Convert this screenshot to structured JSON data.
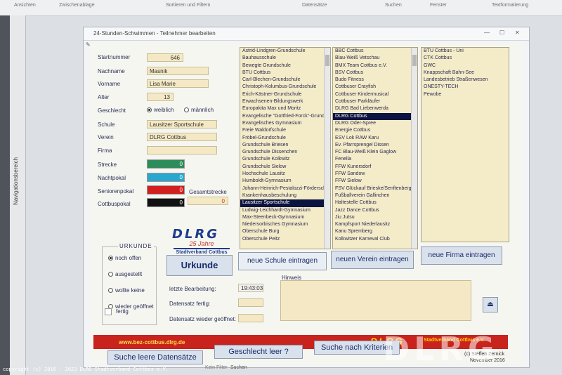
{
  "ribbon": {
    "groups": [
      "Ansichten",
      "Zwischenablage",
      "Sortieren und Filtern",
      "Datensätze",
      "Suchen",
      "Fenster",
      "Textformatierung"
    ]
  },
  "navpane": {
    "label": "Navigationsbereich"
  },
  "window": {
    "title": "24-Stunden-Schwimmen  -  Teilnehmer bearbeiten"
  },
  "form": {
    "startnummer": {
      "label": "Startnummer",
      "value": "646"
    },
    "nachname": {
      "label": "Nachname",
      "value": "Masnik"
    },
    "vorname": {
      "label": "Vorname",
      "value": "Lisa Marie"
    },
    "alter": {
      "label": "Alter",
      "value": "13"
    },
    "geschlecht": {
      "label": "Geschlecht",
      "options": [
        "weiblich",
        "männlich"
      ],
      "selected": "weiblich"
    },
    "schule": {
      "label": "Schule",
      "value": "Lausitzer Sportschule"
    },
    "verein": {
      "label": "Verein",
      "value": "DLRG Cottbus"
    },
    "firma": {
      "label": "Firma",
      "value": ""
    },
    "strecke": {
      "label": "Strecke",
      "value": "0",
      "color": "#2e8b5a"
    },
    "nachtpokal": {
      "label": "Nachtpokal",
      "value": "0",
      "color": "#2aa7cf"
    },
    "seniorenpokal": {
      "label": "Seniorenpokal",
      "value": "0",
      "color": "#d21f1f"
    },
    "cottbuspokal": {
      "label": "Cottbuspokal",
      "value": "0",
      "color": "#111111"
    },
    "gesamtstrecke": {
      "label": "Gesamtstrecke",
      "value": "0"
    }
  },
  "urkunde": {
    "title": "URKUNDE",
    "options": [
      "noch offen",
      "ausgestellt",
      "wollte keine",
      "wieder geöffnet"
    ],
    "selected": "noch offen",
    "fertig_label": "fertig"
  },
  "logo": {
    "brand": "DLRG",
    "years": "25 Jahre",
    "org": "Stadtverband Cottbus"
  },
  "schulen": [
    "Astrid-Lindgren-Grundschule",
    "Bauhausschule",
    "Bewegte Grundschule",
    "BTU Cottbus",
    "Carl-Blechen-Grundschule",
    "Christoph-Kolumbus-Grundschule",
    "Erich-Kästner-Grundschule",
    "Erwachsenen-Bildungswerk",
    "Europakita Max und Moritz",
    "Evangelische \"Gottfried-Forck\"-Grund",
    "Evangelisches Gymnasium",
    "Freie Waldorfschule",
    "Fröbel-Grundschule",
    "Grundschule Briesen",
    "Grundschule Dissenchen",
    "Grundschule Kolkwitz",
    "Grundschule Sielow",
    "Hochschule Lausitz",
    "Humboldt-Gymnasium",
    "Johann-Heinrich-Pestalozzi-Förderscl",
    "Krankenhausbeschulung",
    "Lausitzer Sportschule",
    "Ludwig-Leichhardt-Gymnasium",
    "Max-Steenbeck-Gymnasium",
    "Niedersorbisches Gymnasium",
    "Oberschule Burg",
    "Oberschule Peitz"
  ],
  "schulen_selected": "Lausitzer Sportschule",
  "vereine": [
    "BBC Cottbus",
    "Blau-Weiß Vetschau",
    "BMX Team Cottbus e.V.",
    "BSV Cottbus",
    "Budo Fitness",
    "Cottbuser Crayfish",
    "Cottbuser Kindermusical",
    "Cottbuser Parkläufer",
    "DLRG Bad Liebenwerda",
    "DLRG Cottbus",
    "DLRG Oder-Spree",
    "Energie Cottbus",
    "ESV Lok RAW Karu",
    "Ev. Pfarrsprengel Dissen",
    "FC Blau-Weiß Klein Gaglow",
    "Fenella",
    "FFW Kunersdorf",
    "FFW Sandow",
    "FFW Sielow",
    "FSV Glückauf Brieske/Senftenberg",
    "Fußballverein Gallinchen",
    "Haltestelle Cottbus",
    "Jazz Dance Cottbus",
    "Jiu Jutsu",
    "Kampfsport Niederlausitz",
    "Kanu Spremberg",
    "Kolkwitzer Karneval Club"
  ],
  "vereine_selected": "DLRG Cottbus",
  "firmen": [
    "BTU Cottbus - Uni",
    "CTK Cottbus",
    "GWC",
    "Knappschaft Bahn-See",
    "Landesbetrieb Straßenwesen",
    "ONESTY-TECH",
    "Pewobe"
  ],
  "buttons": {
    "urkunde": "Urkunde",
    "neue_schule": "neue Schule eintragen",
    "neuer_verein": "neuen Verein eintragen",
    "neue_firma": "neue Firma eintragen",
    "suche_leere": "Suche leere Datensätze",
    "geschlecht_leer": "Geschlecht leer ?",
    "suche_kriterien": "Suche nach Kriterien"
  },
  "info": {
    "bearbeitung_label": "letzte Bearbeitung:",
    "bearbeitung_value": "19:43:03",
    "fertig_label": "Datensatz fertig:",
    "geoeffnet_label": "Datensatz wieder geöffnet:",
    "hinweis_label": "Hinweis"
  },
  "footer": {
    "url": "www.bez-cottbus.dlrg.de",
    "brand": "DLRG",
    "org": "Stadtverband Cottbus e.V.",
    "credit_line1": "(c) Steffen Zernick",
    "credit_line2": "November 2016"
  },
  "statusbar": {
    "filter": "Kein Filter",
    "search": "Suchen"
  },
  "copyright": "copyright (c) 2016 - 2023 DLRG Stadtverband Cottbus e.V.",
  "watermark": "DLRG"
}
